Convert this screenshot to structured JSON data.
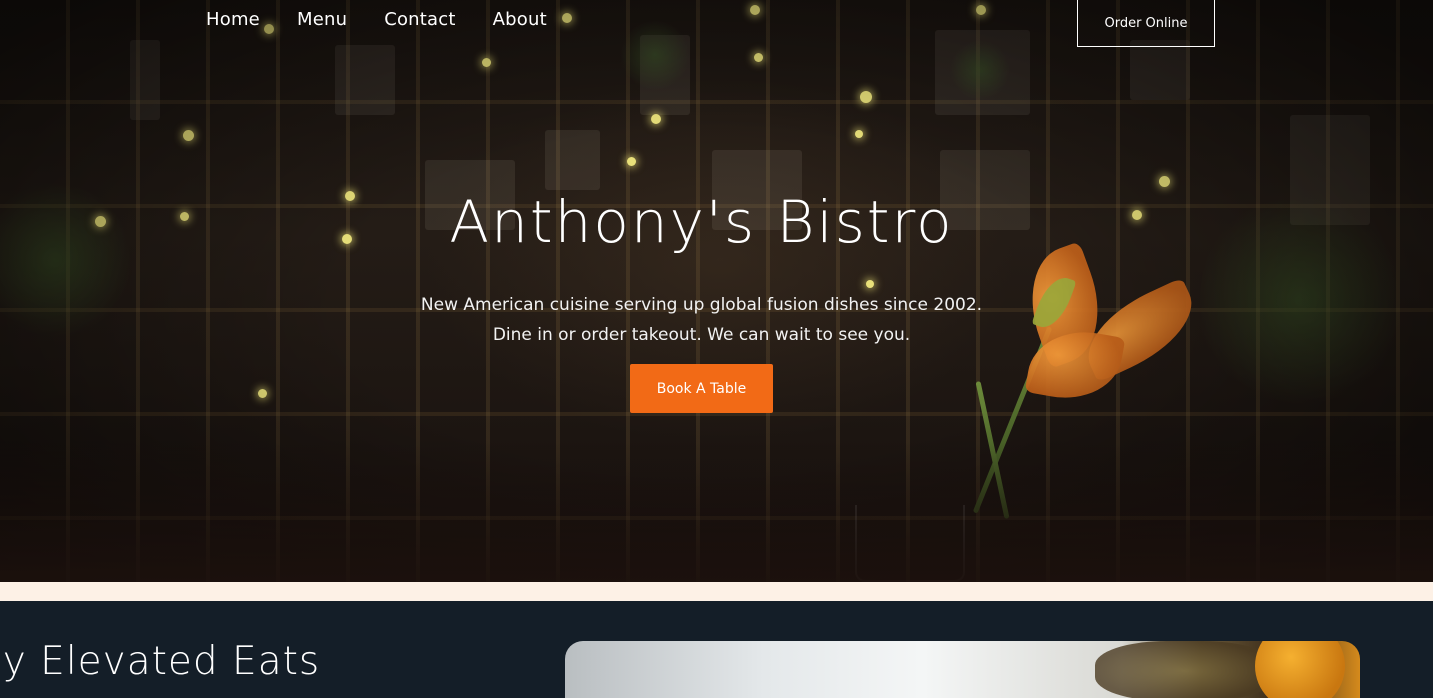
{
  "nav": {
    "links": [
      "Home",
      "Menu",
      "Contact",
      "About"
    ],
    "order_label": "Order Online"
  },
  "hero": {
    "title": "Anthony's Bistro",
    "subtitle_line1": "New American cuisine serving up global fusion dishes since 2002.",
    "subtitle_line2": "Dine in or order takeout. We can wait to see you.",
    "cta_label": "Book A Table",
    "cta_color": "#f26a16"
  },
  "strip": {
    "color": "#fdf1e6"
  },
  "section2": {
    "title": "joy Elevated Eats",
    "background": "#141e28"
  }
}
